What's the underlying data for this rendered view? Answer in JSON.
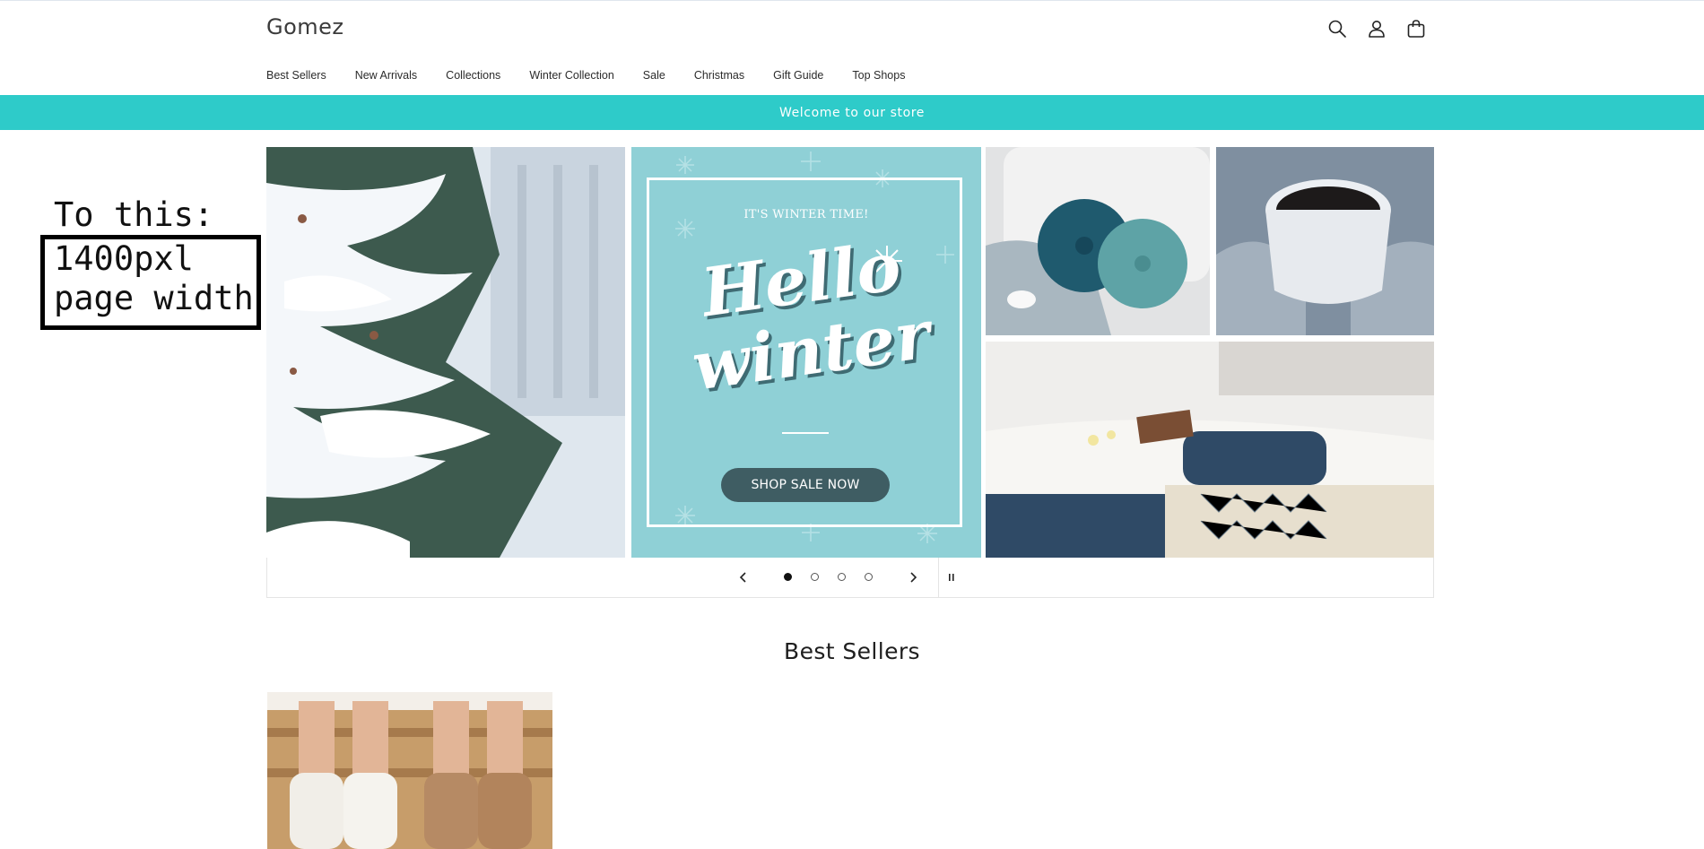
{
  "store": {
    "name": "Gomez"
  },
  "header": {
    "icons": [
      "search-icon",
      "account-icon",
      "cart-icon"
    ]
  },
  "nav": {
    "items": [
      "Best Sellers",
      "New Arrivals",
      "Collections",
      "Winter Collection",
      "Sale",
      "Christmas",
      "Gift Guide",
      "Top Shops"
    ]
  },
  "announcement": {
    "text": "Welcome to our store",
    "color": "#2ecbc9"
  },
  "annotation": {
    "title": "To this:",
    "line1": "1400pxl",
    "line2": "page width"
  },
  "slideshow": {
    "promo": {
      "kicker": "IT'S WINTER TIME!",
      "headline_line1": "Hello",
      "headline_line2": "winter",
      "button": "SHOP SALE NOW"
    },
    "controls": {
      "prev_icon": "chevron-left-icon",
      "next_icon": "chevron-right-icon",
      "pause_icon": "pause-icon",
      "slide_count": 4,
      "active_slide": 1
    }
  },
  "best_sellers": {
    "title": "Best Sellers"
  }
}
